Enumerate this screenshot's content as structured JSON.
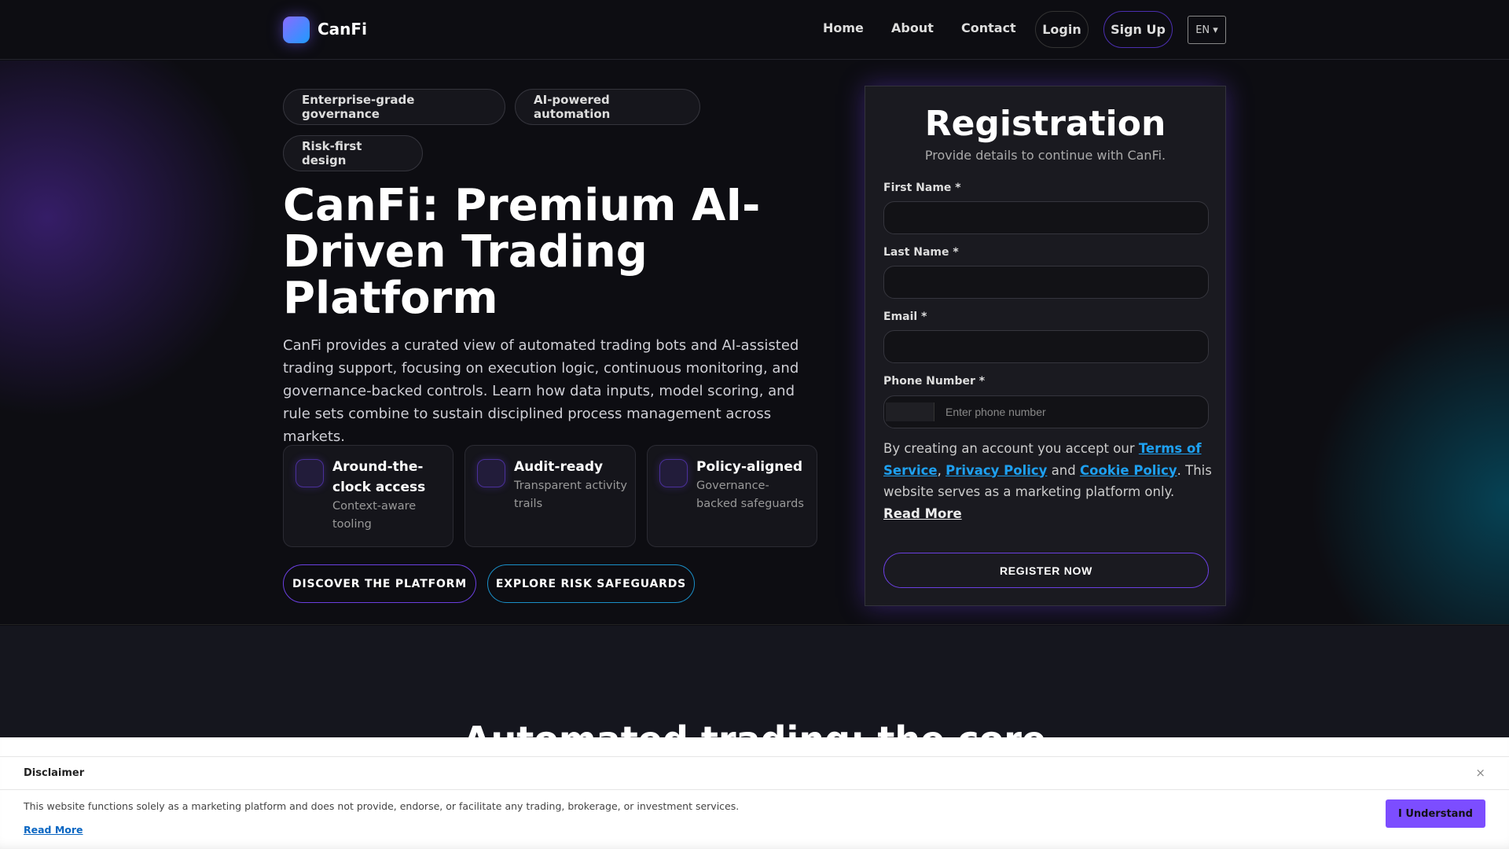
{
  "nav": {
    "brand": "CanFi",
    "links": [
      "Home",
      "About",
      "Contact"
    ],
    "login": "Login",
    "signup": "Sign Up",
    "language": "EN ▾"
  },
  "hero": {
    "badges": [
      "Enterprise-grade governance",
      "AI-powered automation",
      "Risk-first design"
    ],
    "badge_icon": "",
    "title": "CanFi: Premium AI-Driven Trading Platform",
    "description": "CanFi provides a curated view of automated trading bots and AI-assisted trading support, focusing on execution logic, continuous monitoring, and governance-backed controls. Learn how data inputs, model scoring, and rule sets combine to sustain disciplined process management across markets.",
    "features": [
      {
        "title": "Around-the-clock access",
        "desc": "Context-aware tooling"
      },
      {
        "title": "Audit-ready",
        "desc": "Transparent activity trails"
      },
      {
        "title": "Policy-aligned",
        "desc": "Governance-backed safeguards"
      }
    ],
    "cta_primary": "DISCOVER THE PLATFORM",
    "cta_secondary": "EXPLORE RISK SAFEGUARDS"
  },
  "form": {
    "title": "Registration",
    "subtitle": "Provide details to continue with CanFi.",
    "first_name_label": "First Name *",
    "last_name_label": "Last Name *",
    "email_label": "Email *",
    "phone_label": "Phone Number *",
    "phone_placeholder": "Enter phone number",
    "terms_prefix": "By creating an account you accept our ",
    "terms_link": "Terms of Service",
    "comma": ", ",
    "privacy_link": "Privacy Policy",
    "and": " and ",
    "cookie_link": "Cookie Policy",
    "terms_suffix": ". This website serves as a marketing platform only. ",
    "read_more": "Read More",
    "submit": "REGISTER NOW"
  },
  "section2": {
    "heading": "Automated trading: the core"
  },
  "disclaimer": {
    "title": "Disclaimer",
    "close": "×",
    "text": "This website functions solely as a marketing platform and does not provide, endorse, or facilitate any trading, brokerage, or investment services.",
    "read_more": "Read More",
    "button": "I Understand"
  }
}
